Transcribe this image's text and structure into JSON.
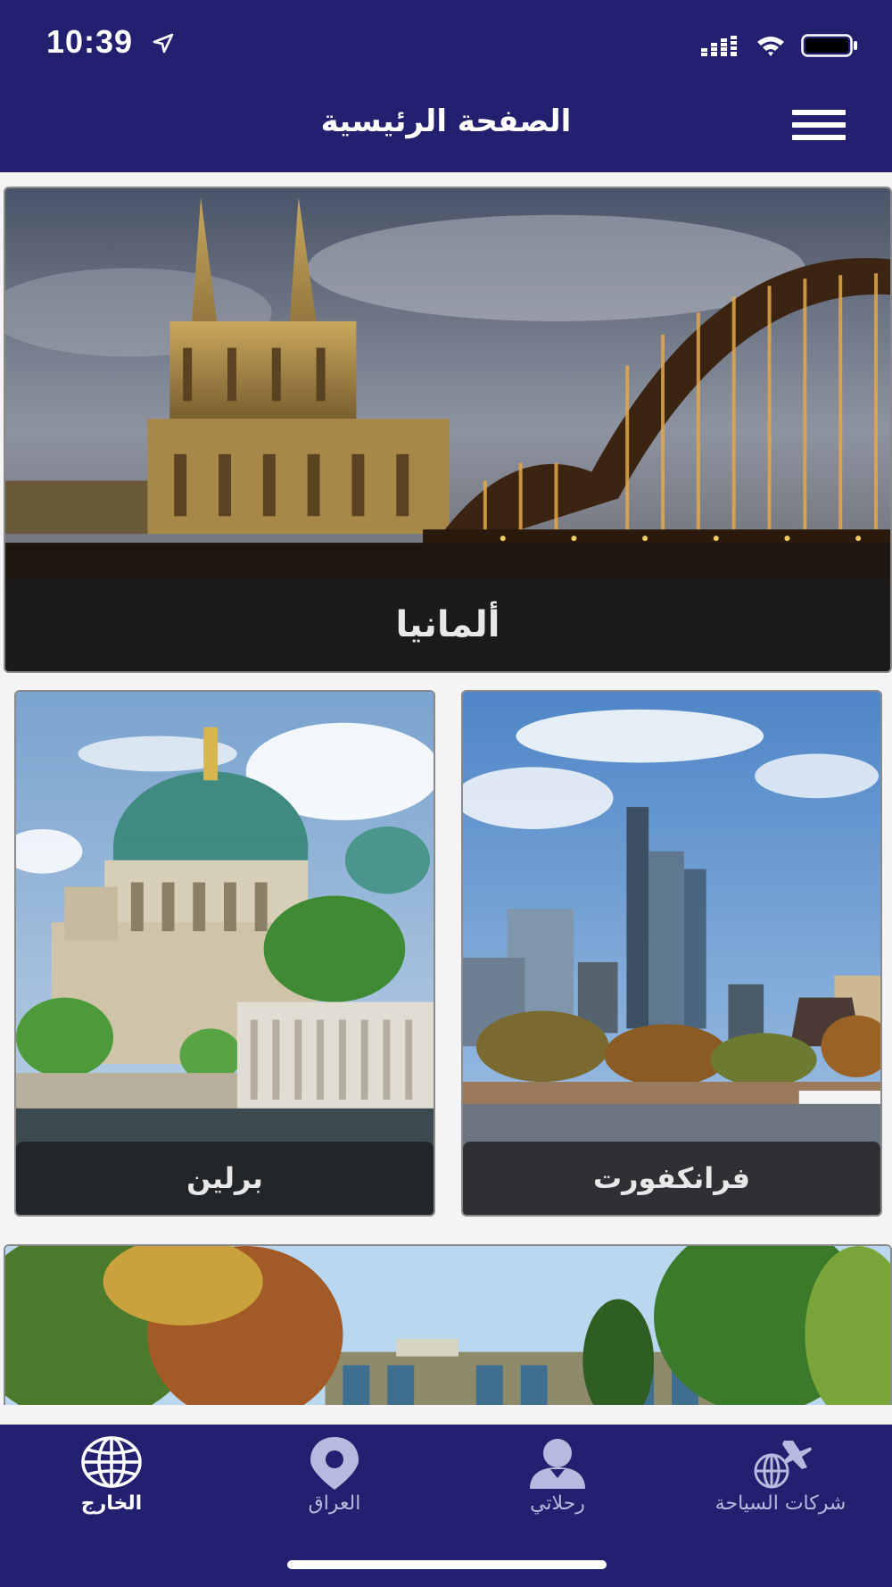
{
  "status_bar": {
    "time": "10:39"
  },
  "header": {
    "title": "الصفحة الرئيسية"
  },
  "cards": {
    "germany": {
      "label": "ألمانيا"
    },
    "berlin": {
      "label": "برلين"
    },
    "frankfurt": {
      "label": "فرانكفورت"
    }
  },
  "bottom_nav": {
    "items": [
      {
        "label": "الخارج",
        "icon": "globe-icon",
        "active": true
      },
      {
        "label": "العراق",
        "icon": "location-pin-icon",
        "active": false
      },
      {
        "label": "رحلاتي",
        "icon": "user-icon",
        "active": false
      },
      {
        "label": "شركات السياحة",
        "icon": "travel-agency-icon",
        "active": false
      }
    ]
  },
  "colors": {
    "primary": "#22206f",
    "nav_inactive": "#b7b9de",
    "background": "#f4f4f6"
  }
}
